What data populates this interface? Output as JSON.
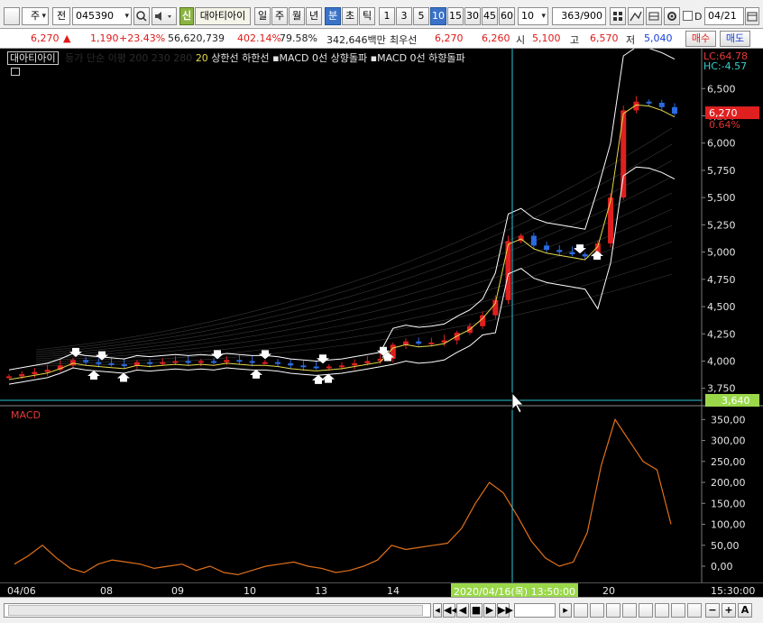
{
  "toolbar": {
    "market": "주",
    "market_type": "전",
    "code": "045390",
    "badge": "신",
    "name": "대아티아이",
    "periods": [
      "일",
      "주",
      "월",
      "년"
    ],
    "tick_types": [
      "분",
      "초",
      "틱"
    ],
    "active_tick_type": "분",
    "intervals": [
      "1",
      "3",
      "5",
      "10",
      "15",
      "30",
      "45",
      "60"
    ],
    "active_interval": "10",
    "interval_select": "10",
    "count_display": "363/900",
    "check_label": "D",
    "date": "04/21"
  },
  "quote": {
    "price": "6,270",
    "arrow": "▲",
    "change": "1,190",
    "change_pct": "+23.43%",
    "volume": "56,620,739",
    "volume_ratio": "402.14%",
    "turnover": "79.58%",
    "amount": "342,646백만",
    "best_label": "최우선",
    "best_ask": "6,270",
    "best_bid": "6,260",
    "open_label": "시",
    "open": "5,100",
    "high_label": "고",
    "high": "6,570",
    "low_label": "저",
    "low": "5,040",
    "buy_label": "매수",
    "sell_label": "매도"
  },
  "legend": {
    "name": "대아티아이",
    "hidden_text": "등가 단순 이평 200 230 280",
    "period": "20",
    "upper_label": "상한선",
    "lower_label": "하한선",
    "signal_up": "MACD 0선 상향돌파",
    "signal_down": "MACD 0선 하향돌파"
  },
  "price_panel": {
    "lc": "LC:64.78",
    "hc": "HC:-4.57",
    "current_price": "6,270",
    "current_pct": "0.64%",
    "crosshair_price": "3,640",
    "axis_ticks": [
      "6,500",
      "6,250",
      "6,000",
      "5,750",
      "5,500",
      "5,250",
      "5,000",
      "4,750",
      "4,500",
      "4,250",
      "4,000",
      "3,750"
    ]
  },
  "macd_panel": {
    "title": "MACD",
    "axis_ticks": [
      "350,00",
      "300,00",
      "250,00",
      "200,00",
      "150,00",
      "100,00",
      "50,00",
      "0,00"
    ]
  },
  "xaxis": {
    "labels": [
      "04/06",
      "08",
      "09",
      "10",
      "13",
      "14",
      "20"
    ],
    "crosshair_time": "2020/04/16(목) 13:50:00",
    "end_time": "15:30:00"
  },
  "scroll": {
    "minus": "−",
    "plus": "+",
    "auto": "A"
  },
  "chart_data": {
    "type": "candlestick",
    "price_series_approx": [
      3860,
      3880,
      3900,
      3920,
      3960,
      4010,
      3990,
      3980,
      3970,
      3960,
      3990,
      3980,
      3990,
      4000,
      3990,
      4000,
      3990,
      4010,
      4000,
      3990,
      3990,
      3980,
      3960,
      3950,
      3940,
      3950,
      3960,
      3980,
      4000,
      4020,
      4150,
      4180,
      4160,
      4170,
      4190,
      4260,
      4320,
      4420,
      4560,
      5100,
      5150,
      5060,
      5020,
      5000,
      4980,
      4960,
      5080,
      5500,
      6300,
      6380,
      6370,
      6330,
      6270
    ],
    "ylim_price": [
      3640,
      6800
    ],
    "macd_series_approx": [
      5,
      25,
      50,
      20,
      -5,
      -15,
      5,
      15,
      10,
      5,
      -5,
      0,
      5,
      -10,
      0,
      -15,
      -20,
      -10,
      0,
      5,
      10,
      0,
      -5,
      -15,
      -10,
      0,
      15,
      50,
      40,
      45,
      50,
      55,
      90,
      150,
      200,
      175,
      120,
      60,
      20,
      0,
      10,
      80,
      240,
      350,
      300,
      250,
      230,
      100
    ],
    "ylim_macd": [
      -30,
      370
    ],
    "highlighted_x": "2020/04/16(목) 13:50:00",
    "crosshair_price": "3,640"
  }
}
